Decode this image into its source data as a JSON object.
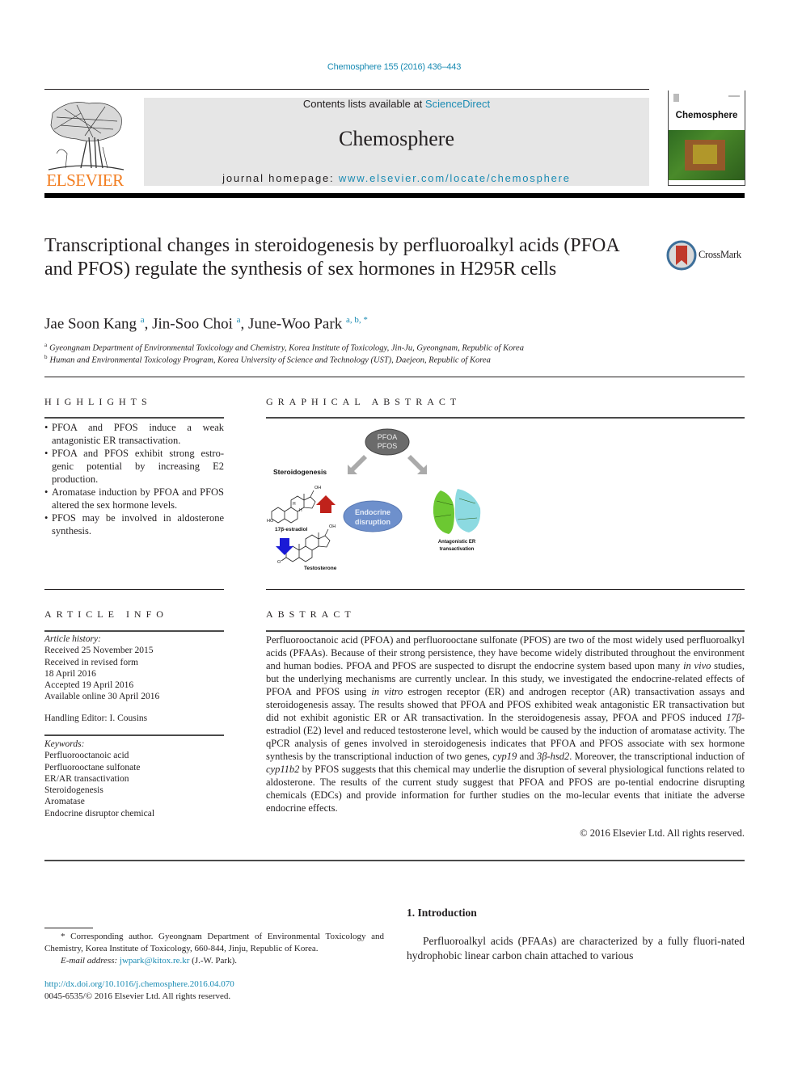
{
  "header": {
    "citation": "Chemosphere 155 (2016) 436–443",
    "contents_prefix": "Contents lists available at ",
    "contents_link": "ScienceDirect",
    "journal_name": "Chemosphere",
    "homepage_prefix": "journal homepage: ",
    "homepage_link": "www.elsevier.com/locate/chemosphere",
    "publisher_logo_text": "ELSEVIER",
    "cover_title": "Chemosphere",
    "brand_orange": "#f27d20",
    "link_color": "#1a8bb3"
  },
  "article": {
    "title": "Transcriptional changes in steroidogenesis by perfluoroalkyl acids (PFOA and PFOS) regulate the synthesis of sex hormones in H295R cells",
    "crossmark_label": "CrossMark",
    "authors": [
      {
        "name": "Jae Soon Kang",
        "sup": "a"
      },
      {
        "name": "Jin-Soo Choi",
        "sup": "a"
      },
      {
        "name": "June-Woo Park",
        "sup": "a, b, *"
      }
    ],
    "affiliations": [
      {
        "mark": "a",
        "text": "Gyeongnam Department of Environmental Toxicology and Chemistry, Korea Institute of Toxicology, Jin-Ju, Gyeongnam, Republic of Korea"
      },
      {
        "mark": "b",
        "text": "Human and Environmental Toxicology Program, Korea University of Science and Technology (UST), Daejeon, Republic of Korea"
      }
    ]
  },
  "highlights": {
    "heading": "HIGHLIGHTS",
    "items": [
      "PFOA and PFOS induce a weak antagonistic ER transactivation.",
      "PFOA and PFOS exhibit strong estro-genic potential by increasing E2 production.",
      "Aromatase induction by PFOA and PFOS altered the sex hormone levels.",
      "PFOS may be involved in aldosterone synthesis."
    ]
  },
  "graphical_abstract": {
    "heading": "GRAPHICAL ABSTRACT",
    "node_top_line1": "PFOA",
    "node_top_line2": "PFOS",
    "steroidogenesis_label": "Steroidogenesis",
    "center_line1": "Endocrine",
    "center_line2": "disruption",
    "estradiol_label": "17β-estradiol",
    "testosterone_label": "Testosterone",
    "receptor_label_line1": "Antagonistic ER",
    "receptor_label_line2": "transactivation",
    "oh_label": "OH",
    "ho_label": "HO",
    "h_label": "H",
    "o_label": "O"
  },
  "article_info": {
    "heading": "ARTICLE INFO",
    "history_label": "Article history:",
    "history": [
      "Received 25 November 2015",
      "Received in revised form",
      "18 April 2016",
      "Accepted 19 April 2016",
      "Available online 30 April 2016"
    ],
    "handling_editor": "Handling Editor: I. Cousins",
    "keywords_label": "Keywords:",
    "keywords": [
      "Perfluorooctanoic acid",
      "Perfluorooctane sulfonate",
      "ER/AR transactivation",
      "Steroidogenesis",
      "Aromatase",
      "Endocrine disruptor chemical"
    ]
  },
  "abstract": {
    "heading": "ABSTRACT",
    "segments": [
      {
        "t": "Perfluorooctanoic acid (PFOA) and perfluorooctane sulfonate (PFOS) are two of the most widely used perfluoroalkyl acids (PFAAs). Because of their strong persistence, they have become widely distributed throughout the environment and human bodies. PFOA and PFOS are suspected to disrupt the endocrine system based upon many "
      },
      {
        "t": "in vivo",
        "i": true
      },
      {
        "t": " studies, but the underlying mechanisms are currently unclear. In this study, we investigated the endocrine-related effects of PFOA and PFOS using "
      },
      {
        "t": "in vitro",
        "i": true
      },
      {
        "t": " estrogen receptor (ER) and androgen receptor (AR) transactivation assays and steroidogenesis assay. The results showed that PFOA and PFOS exhibited weak antagonistic ER transactivation but did not exhibit agonistic ER or AR transactivation. In the steroidogenesis assay, PFOA and PFOS induced "
      },
      {
        "t": "17β",
        "i": true
      },
      {
        "t": "-estradiol (E2) level and reduced testosterone level, which would be caused by the induction of aromatase activity. The qPCR analysis of genes involved in steroidogenesis indicates that PFOA and PFOS associate with sex hormone synthesis by the transcriptional induction of two genes, "
      },
      {
        "t": "cyp19",
        "i": true
      },
      {
        "t": " and "
      },
      {
        "t": "3β-hsd2",
        "i": true
      },
      {
        "t": ". Moreover, the transcriptional induction of "
      },
      {
        "t": "cyp11b2",
        "i": true
      },
      {
        "t": " by PFOS suggests that this chemical may underlie the disruption of several physiological functions related to aldosterone. The results of the current study suggest that PFOA and PFOS are po-tential endocrine disrupting chemicals (EDCs) and provide information for further studies on the mo-lecular events that initiate the adverse endocrine effects."
      }
    ],
    "copyright": "© 2016 Elsevier Ltd. All rights reserved."
  },
  "footnotes": {
    "corresponding": "* Corresponding author. Gyeongnam Department of Environmental Toxicology and Chemistry, Korea Institute of Toxicology, 660-844, Jinju, Republic of Korea.",
    "email_label": "E-mail address: ",
    "email": "jwpark@kitox.re.kr",
    "email_suffix": " (J.-W. Park).",
    "doi": "http://dx.doi.org/10.1016/j.chemosphere.2016.04.070",
    "issn": "0045-6535/© 2016 Elsevier Ltd. All rights reserved."
  },
  "introduction": {
    "heading": "1.  Introduction",
    "text": "Perfluoroalkyl acids (PFAAs) are characterized by a fully fluori-nated hydrophobic linear carbon chain attached to various"
  }
}
